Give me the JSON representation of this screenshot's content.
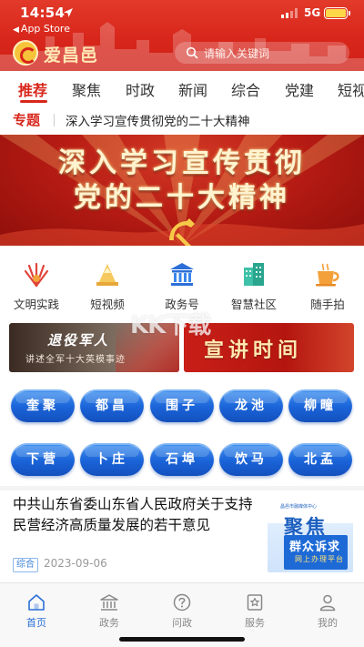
{
  "status_bar": {
    "time": "14:54",
    "back_label": "App Store",
    "network": "5G"
  },
  "header": {
    "app_name": "爱昌邑",
    "search_placeholder": "请输入关键词",
    "brand_color": "#d8261b"
  },
  "tabs": [
    {
      "label": "推荐",
      "active": true
    },
    {
      "label": "聚焦",
      "active": false
    },
    {
      "label": "时政",
      "active": false
    },
    {
      "label": "新闻",
      "active": false
    },
    {
      "label": "综合",
      "active": false
    },
    {
      "label": "党建",
      "active": false
    },
    {
      "label": "短视",
      "active": false
    }
  ],
  "topic": {
    "label": "专题",
    "text": "深入学习宣传贯彻党的二十大精神"
  },
  "banner": {
    "line1": "深入学习宣传贯彻",
    "line2": "党的二十大精神",
    "emblem_icon": "party-emblem-icon"
  },
  "quick_links": [
    {
      "label": "文明实践",
      "icon": "civilization-fan-icon"
    },
    {
      "label": "短视频",
      "icon": "short-video-icon"
    },
    {
      "label": "政务号",
      "icon": "government-building-icon"
    },
    {
      "label": "智慧社区",
      "icon": "smart-community-icon"
    },
    {
      "label": "随手拍",
      "icon": "coffee-cup-icon"
    }
  ],
  "promos": {
    "veterans": {
      "title": "退役军人",
      "subtitle": "讲述全军十大英模事迹"
    },
    "lecture": {
      "title": "宣讲时间"
    }
  },
  "watermark": "KK下载",
  "towns": [
    [
      "奎聚",
      "都昌",
      "围子",
      "龙池",
      "柳疃"
    ],
    [
      "下营",
      "卜庄",
      "石埠",
      "饮马",
      "北孟"
    ]
  ],
  "news": {
    "title": "中共山东省委山东省人民政府关于支持民营经济高质量发展的若干意见",
    "tag": "综合",
    "date": "2023-09-06",
    "thumb": {
      "small": "昌邑市融媒体中心",
      "big": "聚焦",
      "band_title": "群众诉求",
      "band_sub": "网上办理平台"
    }
  },
  "bottom_nav": [
    {
      "label": "首页",
      "icon": "home-icon",
      "active": true
    },
    {
      "label": "政务",
      "icon": "government-icon",
      "active": false
    },
    {
      "label": "问政",
      "icon": "question-icon",
      "active": false
    },
    {
      "label": "服务",
      "icon": "service-icon",
      "active": false
    },
    {
      "label": "我的",
      "icon": "profile-icon",
      "active": false
    }
  ]
}
